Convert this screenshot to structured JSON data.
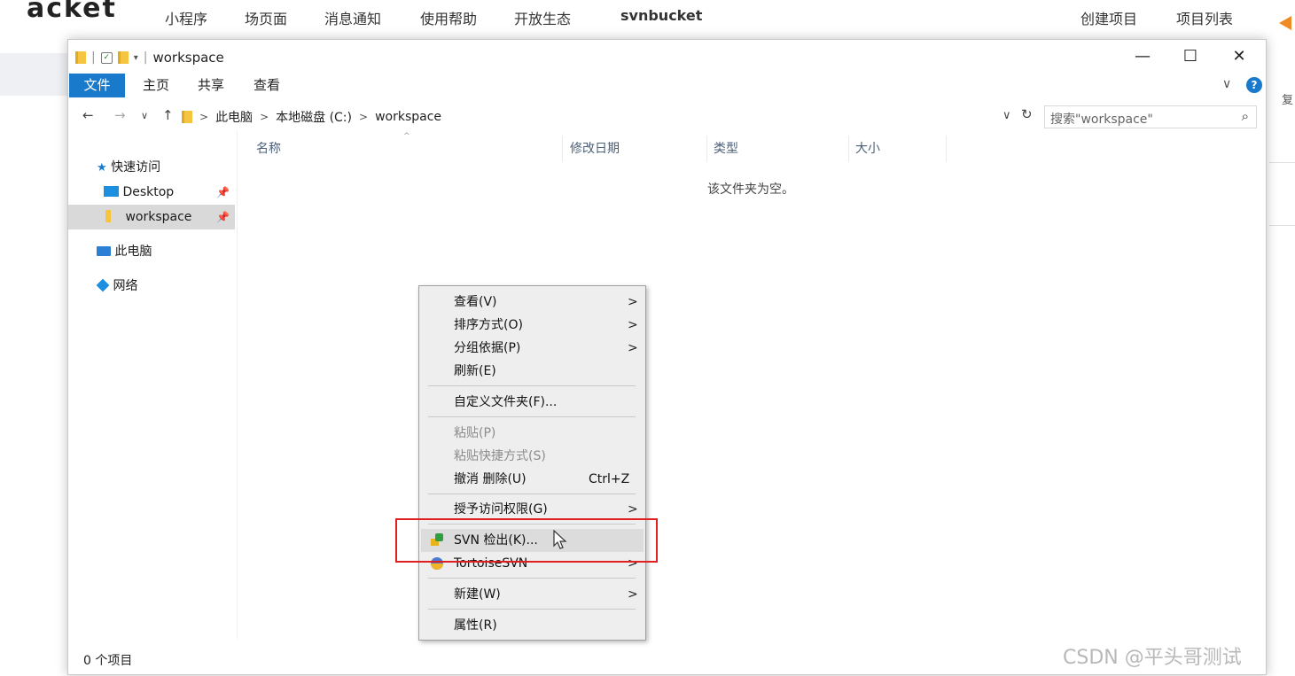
{
  "background_page": {
    "brand": "acket",
    "nav_items": [
      "小程序",
      "场页面",
      "消息通知",
      "使用帮助",
      "开放生态",
      "svnbucket"
    ],
    "right_nav_items": [
      "创建项目",
      "项目列表"
    ],
    "right_panel_text": "复"
  },
  "window": {
    "title": "workspace",
    "controls": {
      "minimize": "—",
      "maximize": "☐",
      "close": "✕"
    }
  },
  "ribbon": {
    "tabs": [
      "文件",
      "主页",
      "共享",
      "查看"
    ],
    "expand_glyph": "∨",
    "help_glyph": "?"
  },
  "address": {
    "back": "←",
    "forward": "→",
    "recent": "∨",
    "up": "↑",
    "crumbs": [
      "此电脑",
      "本地磁盘 (C:)",
      "workspace"
    ],
    "separator": ">",
    "dropdown": "∨",
    "refresh": "↻"
  },
  "search": {
    "placeholder": "搜索\"workspace\"",
    "icon": "⌕"
  },
  "nav_pane": {
    "quick_access": "快速访问",
    "items": [
      {
        "label": "Desktop",
        "pinned": true
      },
      {
        "label": "workspace",
        "pinned": true
      }
    ],
    "this_pc": "此电脑",
    "network": "网络"
  },
  "columns": [
    "名称",
    "修改日期",
    "类型",
    "大小"
  ],
  "empty_message": "该文件夹为空。",
  "status": "0 个项目",
  "context_menu": {
    "items": [
      {
        "label": "查看(V)",
        "submenu": true
      },
      {
        "label": "排序方式(O)",
        "submenu": true
      },
      {
        "label": "分组依据(P)",
        "submenu": true
      },
      {
        "label": "刷新(E)"
      },
      {
        "label": "自定义文件夹(F)..."
      },
      {
        "label": "粘贴(P)",
        "disabled": true
      },
      {
        "label": "粘贴快捷方式(S)",
        "disabled": true
      },
      {
        "label": "撤消 删除(U)",
        "shortcut": "Ctrl+Z"
      },
      {
        "label": "授予访问权限(G)",
        "submenu": true
      },
      {
        "label": "SVN 检出(K)...",
        "icon": "svn-checkout-icon",
        "highlighted": true
      },
      {
        "label": "TortoiseSVN",
        "icon": "tortoisesvn-icon",
        "submenu": true
      },
      {
        "label": "新建(W)",
        "submenu": true
      },
      {
        "label": "属性(R)"
      }
    ],
    "submenu_glyph": ">"
  },
  "watermark": "CSDN @平头哥测试",
  "colors": {
    "file_tab": "#1979ca",
    "highlight_box": "#e02020",
    "selection": "#d9d9d9",
    "menu_bg": "#eeeeee"
  }
}
